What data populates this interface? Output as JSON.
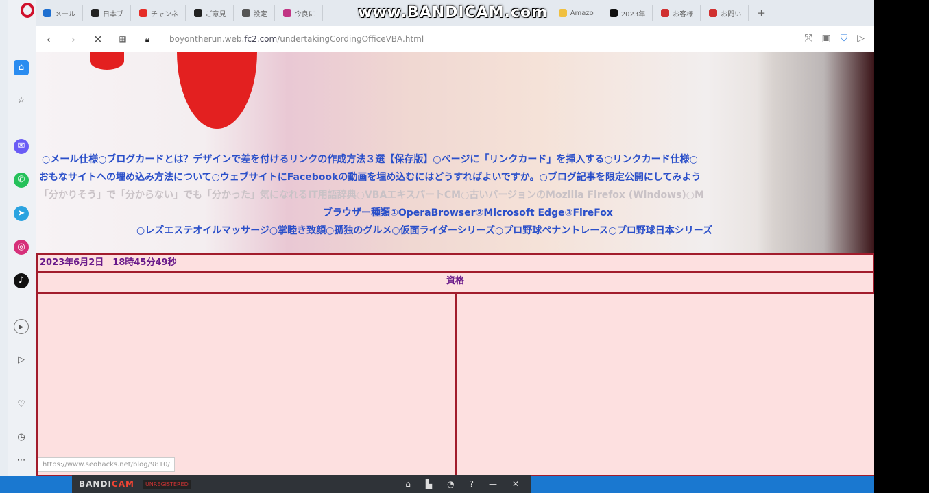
{
  "browser": {
    "tabs": [
      {
        "label": "メール",
        "color": "#1e6fd0"
      },
      {
        "label": "日本ブ",
        "color": "#222222"
      },
      {
        "label": "チャンネ",
        "color": "#e52d27"
      },
      {
        "label": "ご意見",
        "color": "#222222"
      },
      {
        "label": "設定",
        "color": "#555555"
      },
      {
        "label": "今良に",
        "color": "#c13584"
      },
      {
        "label": "Amazo",
        "color": "#f0c040"
      },
      {
        "label": "2023年",
        "color": "#111111"
      },
      {
        "label": "お客様",
        "color": "#d03030"
      },
      {
        "label": "お問い",
        "color": "#d03030"
      }
    ],
    "new_tab": "+",
    "url_host": "boyontherun.web.",
    "url_domain": "fc2.com",
    "url_path": "/undertakingCordingOfficeVBA.html",
    "watermark": "www.BANDICAM.com",
    "status_url": "https://www.seohacks.net/blog/9810/"
  },
  "sidebar_icons": [
    "home",
    "star",
    "messenger",
    "whatsapp",
    "telegram",
    "instagram",
    "tiktok",
    "player",
    "send",
    "heart",
    "history",
    "more"
  ],
  "page": {
    "link_rows": [
      "○メール仕様○ブログカードとは？デザインで差を付けるリンクの作成方法３選【保存版】○ページに「リンクカード」を挿入する○リンクカード仕様○",
      "おもなサイトへの埋め込み方法について○ウェブサイトにFacebookの動画を埋め込むにはどうすればよいですか。○ブログ記事を限定公開にしてみよう",
      "「分かりそう」で「分からない」でも「分かった」気になれるIT用語辞典○VBAエキスパートCM○古いバージョンのMozilla Firefox (Windows)○M",
      "ブラウザー種類①OperaBrowser②Microsoft Edge③FireFox",
      "○レズエステオイルマッサージ○掌睦き致顔○孤独のグルメ○仮面ライダーシリーズ○プロ野球ペナントレース○プロ野球日本シリーズ"
    ],
    "date": "2023年6月2日　18時45分49秒",
    "heading": "資格"
  },
  "bandicam": {
    "logo_a": "BANDI",
    "logo_b": "CAM",
    "unregistered": "UNREGISTERED",
    "controls": [
      "home",
      "folder",
      "timer",
      "?",
      "—",
      "✕"
    ]
  }
}
